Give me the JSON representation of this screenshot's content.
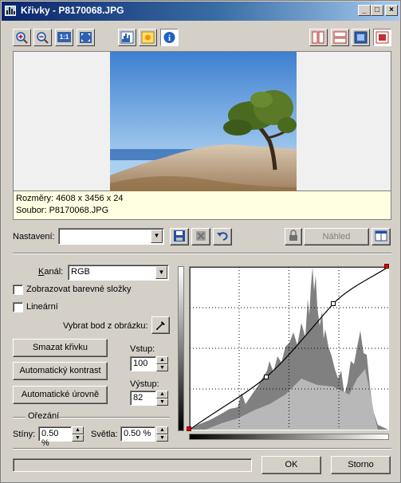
{
  "window": {
    "title": "Křivky - P8170068.JPG",
    "controls": [
      "_",
      "□",
      "×"
    ]
  },
  "toolbar": {
    "zoom_in": "zoom-in-icon",
    "zoom_out": "zoom-out-icon",
    "actual_size": "1:1",
    "fit": "fit-icon",
    "histogram": "histogram-icon",
    "exposure": "exposure-icon",
    "info": "i",
    "view_modes": [
      "split-vertical",
      "split-horizontal",
      "single",
      "red-frame"
    ]
  },
  "preview": {
    "dimensions": "Rozměry: 4608 x 3456 x 24",
    "file": "Soubor: P8170068.JPG"
  },
  "presets": {
    "label": "Nastavení:",
    "value": "",
    "preview_button": "Náhled"
  },
  "channel": {
    "label": "Kanál:",
    "value": "RGB"
  },
  "options": {
    "show_components": "Zobrazovat barevné složky",
    "linear": "Lineární",
    "pick_point": "Vybrat bod z obrázku:"
  },
  "buttons": {
    "reset_curve": "Smazat křivku",
    "auto_contrast": "Automatický kontrast",
    "auto_levels": "Automatické úrovně",
    "ok": "OK",
    "cancel": "Storno"
  },
  "io": {
    "input_label": "Vstup:",
    "input_value": "100",
    "output_label": "Výstup:",
    "output_value": "82"
  },
  "clipping": {
    "group_label": "Ořezání",
    "shadows_label": "Stíny:",
    "shadows_value": "0.50 %",
    "highlights_label": "Světla:",
    "highlights_value": "0.50 %"
  },
  "curve": {
    "control_points": [
      [
        0,
        0
      ],
      [
        100,
        82
      ],
      [
        181,
        167
      ],
      [
        255,
        255
      ]
    ],
    "endpoint_color": "#e00000"
  },
  "colors": {
    "title_gradient_start": "#0a246a",
    "title_gradient_end": "#a6caf0",
    "face": "#d4d0c8",
    "info_background": "#ffffe1"
  }
}
